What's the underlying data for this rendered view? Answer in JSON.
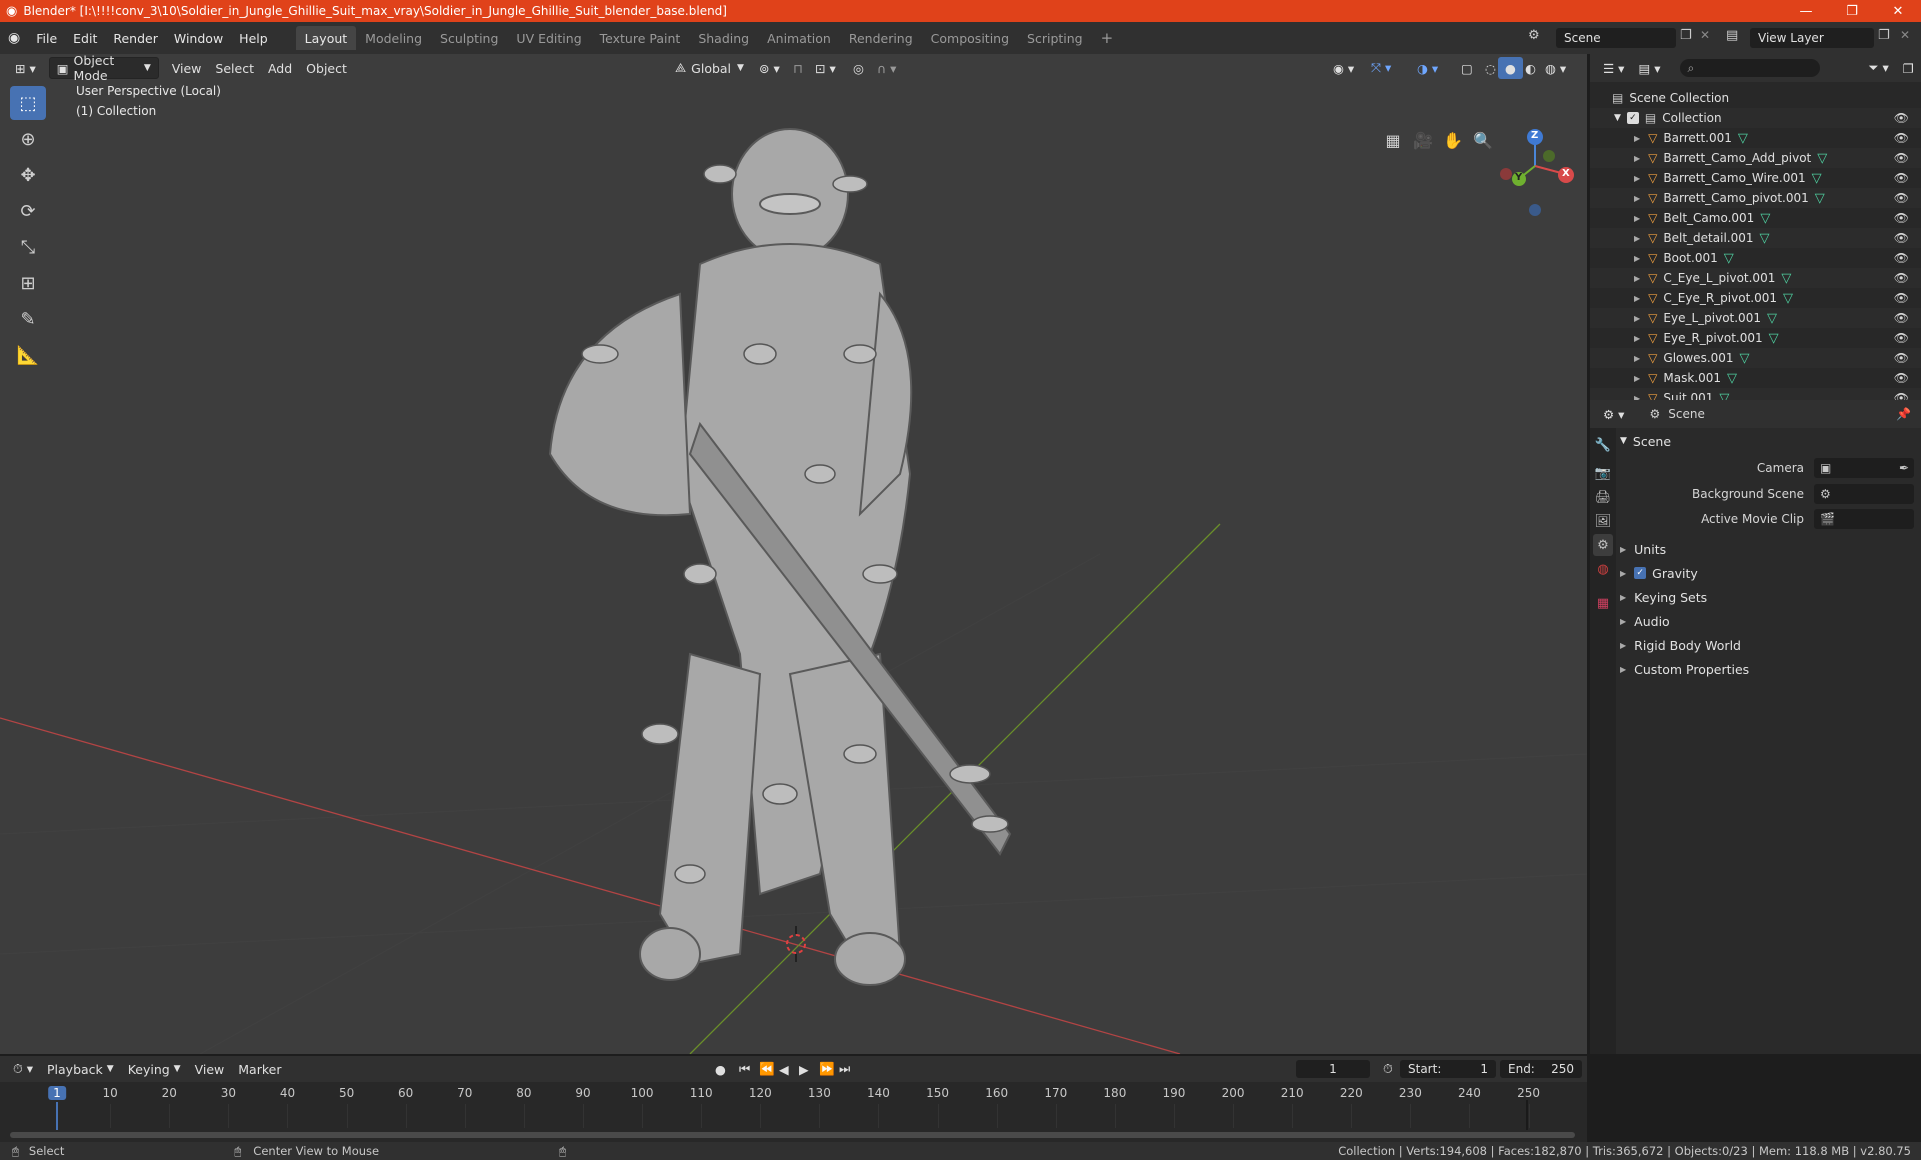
{
  "window": {
    "title": "Blender* [I:\\!!!!conv_3\\10\\Soldier_in_Jungle_Ghillie_Suit_max_vray\\Soldier_in_Jungle_Ghillie_Suit_blender_base.blend]",
    "controls": [
      "—",
      "❐",
      "✕"
    ]
  },
  "menu": [
    "File",
    "Edit",
    "Render",
    "Window",
    "Help"
  ],
  "workspaces": [
    "Layout",
    "Modeling",
    "Sculpting",
    "UV Editing",
    "Texture Paint",
    "Shading",
    "Animation",
    "Rendering",
    "Compositing",
    "Scripting"
  ],
  "active_workspace": "Layout",
  "scene_name": "Scene",
  "view_layer": "View Layer",
  "viewport": {
    "mode": "Object Mode",
    "menus": [
      "View",
      "Select",
      "Add",
      "Object"
    ],
    "orientation": "Global",
    "info_line1": "User Perspective (Local)",
    "info_line2": "(1) Collection",
    "gizmo": {
      "x": "X",
      "y": "Y",
      "z": "Z"
    }
  },
  "outliner": {
    "root": "Scene Collection",
    "collection": "Collection",
    "items": [
      "Barrett.001",
      "Barrett_Camo_Add_pivot",
      "Barrett_Camo_Wire.001",
      "Barrett_Camo_pivot.001",
      "Belt_Camo.001",
      "Belt_detail.001",
      "Boot.001",
      "C_Eye_L_pivot.001",
      "C_Eye_R_pivot.001",
      "Eye_L_pivot.001",
      "Eye_R_pivot.001",
      "Glowes.001",
      "Mask.001",
      "Suit.001"
    ]
  },
  "properties": {
    "context": "Scene",
    "panel": "Scene",
    "camera_label": "Camera",
    "bg_scene_label": "Background Scene",
    "movie_clip_label": "Active Movie Clip",
    "subpanels": [
      "Units",
      "Gravity",
      "Keying Sets",
      "Audio",
      "Rigid Body World",
      "Custom Properties"
    ]
  },
  "timeline": {
    "menus": [
      "Playback",
      "Keying",
      "View",
      "Marker"
    ],
    "current_frame": "1",
    "start_label": "Start:",
    "start": "1",
    "end_label": "End:",
    "end": "250",
    "ticks": [
      "1",
      "10",
      "20",
      "30",
      "40",
      "50",
      "60",
      "70",
      "80",
      "90",
      "100",
      "110",
      "120",
      "130",
      "140",
      "150",
      "160",
      "170",
      "180",
      "190",
      "200",
      "210",
      "220",
      "230",
      "240",
      "250"
    ]
  },
  "status": {
    "select": "Select",
    "center": "Center View to Mouse",
    "stats": "Collection | Verts:194,608 | Faces:182,870 | Tris:365,672 | Objects:0/23 | Mem: 118.8 MB | v2.80.75"
  }
}
